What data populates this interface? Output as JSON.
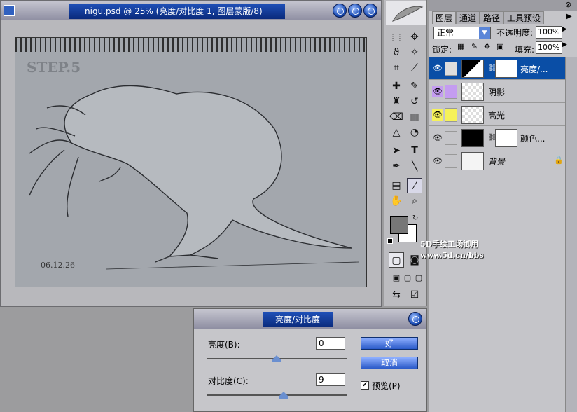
{
  "document": {
    "title": "nigu.psd @ 25% (亮度/对比度 1, 图层蒙版/8)",
    "step_label": "STEP.5",
    "date_label": "06.12.26"
  },
  "layers_panel": {
    "tabs": [
      "图层",
      "通道",
      "路径",
      "工具预设"
    ],
    "blend_mode": "正常",
    "opacity_label": "不透明度:",
    "opacity_value": "100%",
    "lock_label": "锁定:",
    "fill_label": "填充:",
    "fill_value": "100%",
    "layers": [
      {
        "name": "亮度/...",
        "selected": true
      },
      {
        "name": "阴影",
        "color": "#c49cf0"
      },
      {
        "name": "高光",
        "color": "#f6f25a"
      },
      {
        "name": "颜色..."
      },
      {
        "name": "背景"
      }
    ]
  },
  "dialog": {
    "title": "亮度/对比度",
    "brightness_label": "亮度(B):",
    "brightness_value": "0",
    "brightness_slider": 0.5,
    "contrast_label": "对比度(C):",
    "contrast_value": "9",
    "contrast_slider": 0.55,
    "ok_label": "好",
    "cancel_label": "取消",
    "preview_label": "预览(P)",
    "preview_checked": true
  },
  "watermark": {
    "line1": "5D手绘工场御用",
    "line2": "www.5d.cn/bbs"
  }
}
